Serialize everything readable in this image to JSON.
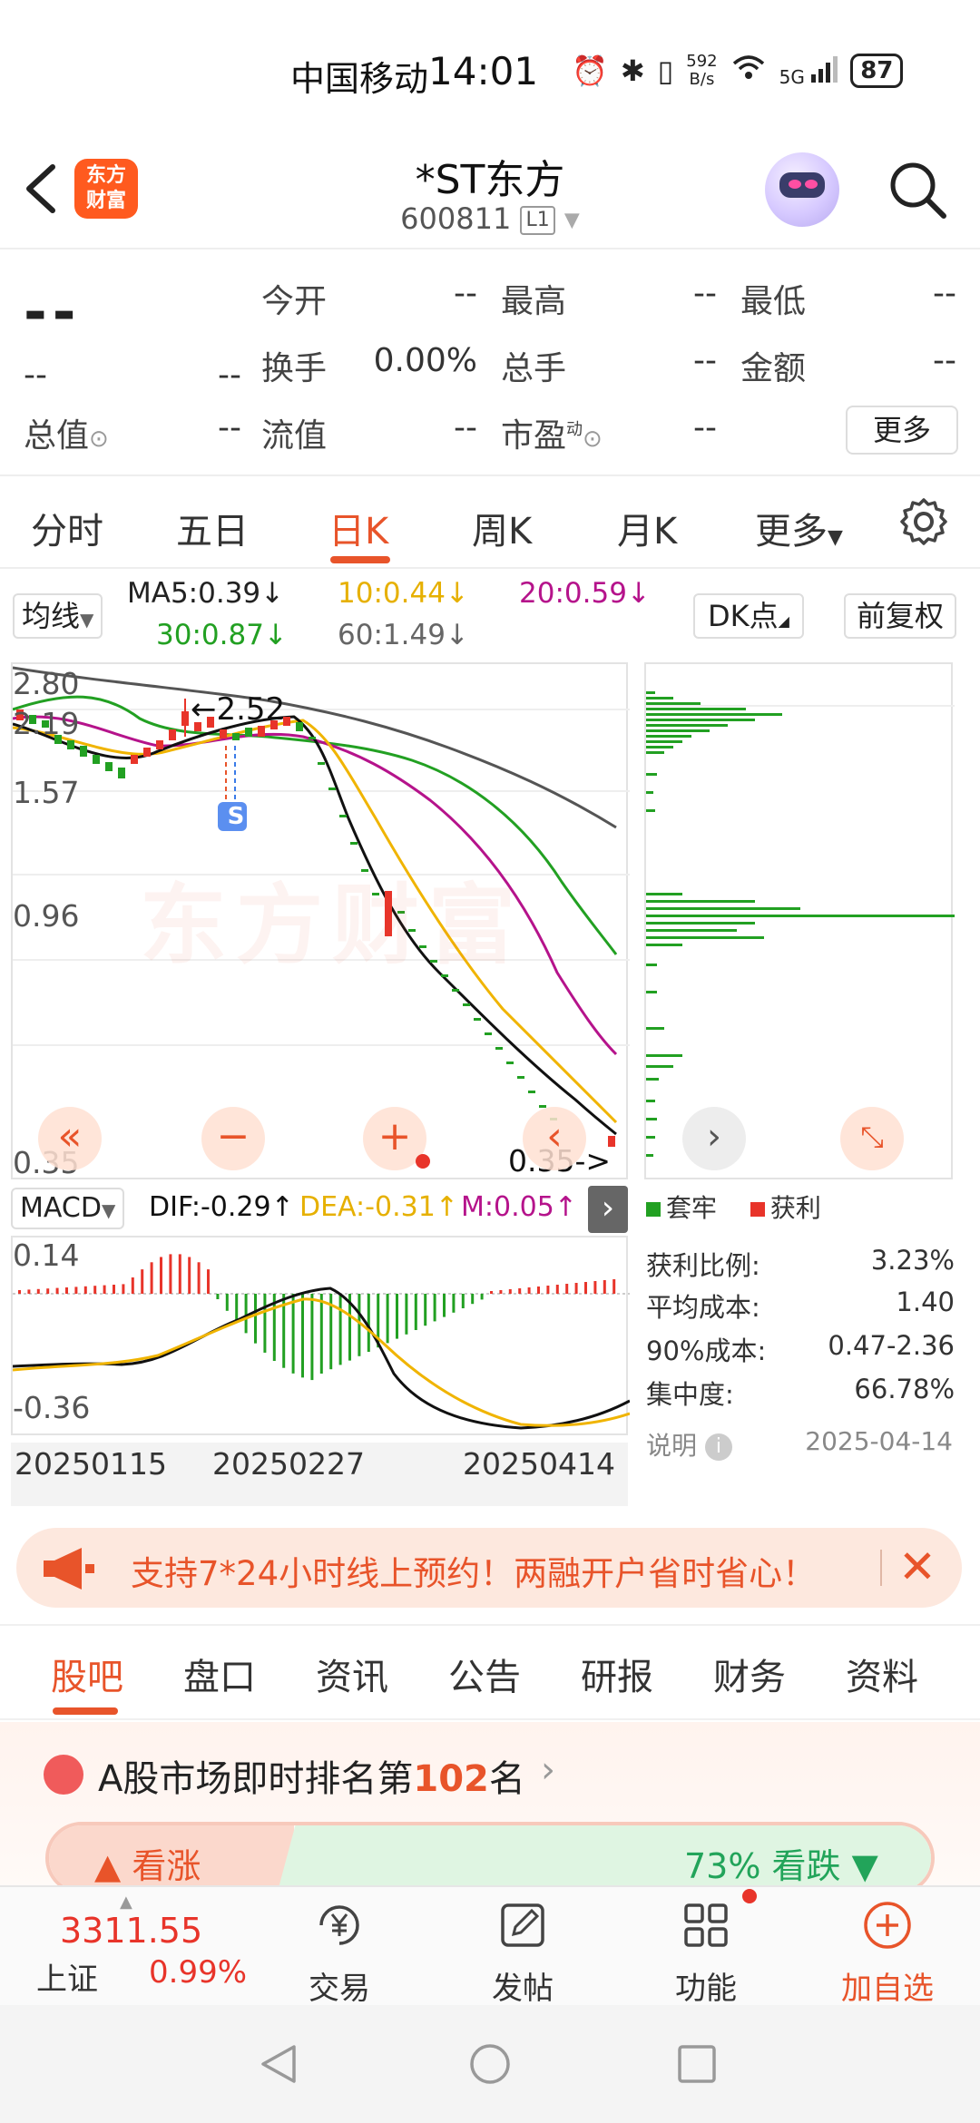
{
  "status": {
    "carrier": "中国移动",
    "time": "14:01",
    "net_speed": "592",
    "net_unit": "B/s",
    "battery": "87",
    "signal": "5G"
  },
  "header": {
    "logo_line1": "东方",
    "logo_line2": "财富",
    "title": "*ST东方",
    "code": "600811",
    "level": "L1"
  },
  "quote": {
    "price": "--",
    "change": "--",
    "change_pct": "--",
    "rows": [
      [
        {
          "label": "今开",
          "value": "--"
        },
        {
          "label": "最高",
          "value": "--"
        },
        {
          "label": "最低",
          "value": "--"
        }
      ],
      [
        {
          "label": "换手",
          "value": "0.00%"
        },
        {
          "label": "总手",
          "value": "--"
        },
        {
          "label": "金额",
          "value": "--"
        }
      ],
      [
        {
          "label": "流值",
          "value": "--"
        },
        {
          "label": "市盈",
          "value": "--"
        }
      ]
    ],
    "total_value_label": "总值",
    "total_value": "--",
    "pe_superscript": "动",
    "more": "更多"
  },
  "period_tabs": [
    "分时",
    "五日",
    "日K",
    "周K",
    "月K",
    "更多"
  ],
  "ma": {
    "selector": "均线",
    "ma5": "MA5:0.39↓",
    "ma10": "10:0.44↓",
    "ma20": "20:0.59↓",
    "ma30": "30:0.87↓",
    "ma60": "60:1.49↓",
    "dk": "DK点",
    "adjust": "前复权"
  },
  "kchart": {
    "y_labels": [
      "2.80",
      "2.19",
      "1.57",
      "0.96",
      "0.35"
    ],
    "high_marker": "←2.52",
    "low_marker": "0.35->",
    "signal_badge": "S",
    "watermark": "东方财富"
  },
  "macd": {
    "selector": "MACD",
    "dif": "DIF:-0.29↑",
    "dea": "DEA:-0.31↑",
    "m": "M:0.05↑",
    "y_top": "0.14",
    "y_bottom": "-0.36",
    "dates": [
      "20250115",
      "20250227",
      "20250414"
    ]
  },
  "chip": {
    "legend_trap": "套牢",
    "legend_profit": "获利",
    "stats": [
      {
        "label": "获利比例:",
        "value": "3.23%"
      },
      {
        "label": "平均成本:",
        "value": "1.40"
      },
      {
        "label": "90%成本:",
        "value": "0.47-2.36"
      },
      {
        "label": "集中度:",
        "value": "66.78%"
      }
    ],
    "note": "说明",
    "date": "2025-04-14"
  },
  "banner": {
    "text": "支持7*24小时线上预约！两融开户省时省心！"
  },
  "bottom_tabs": [
    "股吧",
    "盘口",
    "资讯",
    "公告",
    "研报",
    "财务",
    "资料"
  ],
  "rank": {
    "prefix": "A股市场即时排名第",
    "num": "102",
    "suffix": "名",
    "up_label": "看涨",
    "down_label": "73% 看跌"
  },
  "bottombar": {
    "index_value": "3311.55",
    "index_name": "上证",
    "index_change": "0.99%",
    "nav": [
      "交易",
      "发帖",
      "功能",
      "加自选"
    ]
  },
  "colors": {
    "accent": "#e8542a",
    "up": "#e8342a",
    "down": "#22a022"
  }
}
